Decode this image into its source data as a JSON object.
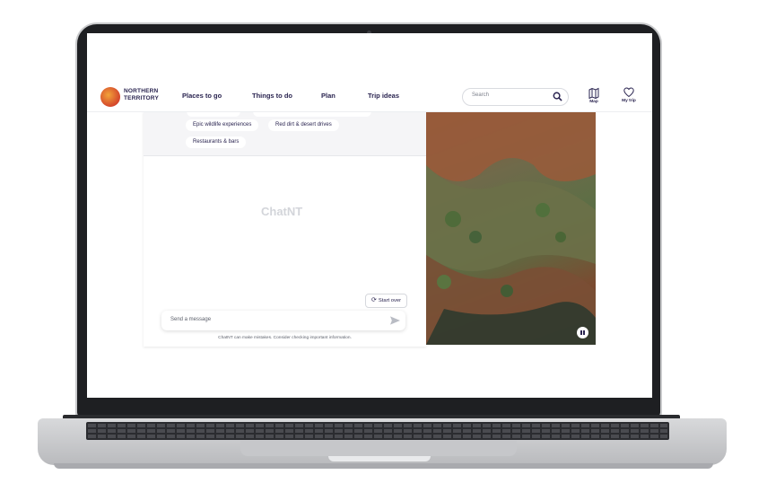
{
  "nav": {
    "logo_line1": "NORTHERN",
    "logo_line2": "TERRITORY",
    "links": [
      "Places to go",
      "Things to do",
      "Plan",
      "Trip ideas"
    ],
    "search_placeholder": "Search",
    "map_label": "Map",
    "mytrip_label": "My trip"
  },
  "chat": {
    "chips": [
      "Epic wildlife experiences",
      "Red dirt & desert drives",
      "Restaurants & bars"
    ],
    "title": "ChatNT",
    "start_over": "Start over",
    "message_placeholder": "Send a message",
    "disclaimer": "ChatNT can make mistakes. Consider checking important information."
  },
  "colors": {
    "brand_navy": "#2a2450",
    "brand_orange": "#f2a33a",
    "brand_red": "#d4462b"
  },
  "icons": [
    "search-icon",
    "map-icon",
    "heart-icon",
    "refresh-icon",
    "send-icon",
    "pause-icon"
  ]
}
